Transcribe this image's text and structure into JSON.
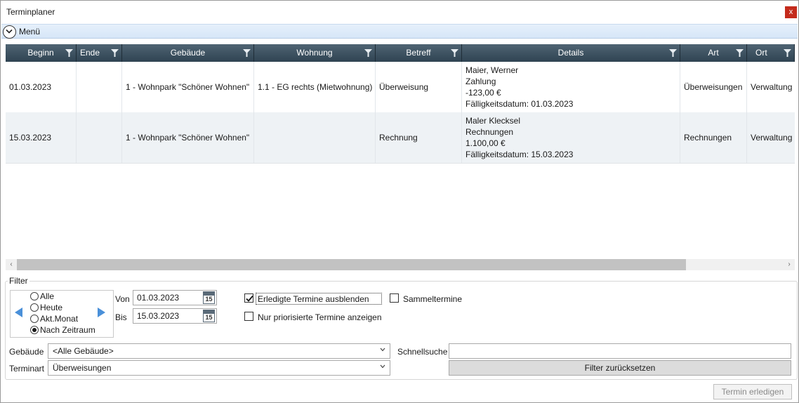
{
  "window": {
    "title": "Terminplaner",
    "close_label": "x"
  },
  "menu": {
    "label": "Menü"
  },
  "grid": {
    "columns": [
      "Beginn",
      "Ende",
      "Gebäude",
      "Wohnung",
      "Betreff",
      "Details",
      "Art",
      "Ort"
    ],
    "rows": [
      {
        "beginn": "01.03.2023",
        "ende": "",
        "gebaeude": "1 - Wohnpark \"Schöner Wohnen\"",
        "wohnung": "1.1 - EG rechts (Mietwohnung)",
        "betreff": "Überweisung",
        "details": [
          "Maier, Werner",
          "Zahlung",
          "-123,00 €",
          "Fälligkeitsdatum: 01.03.2023"
        ],
        "art": "Überweisungen",
        "ort": "Verwaltung"
      },
      {
        "beginn": "15.03.2023",
        "ende": "",
        "gebaeude": "1 - Wohnpark \"Schöner Wohnen\"",
        "wohnung": "",
        "betreff": "Rechnung",
        "details": [
          "Maler Klecksel",
          "Rechnungen",
          "1.100,00 €",
          "Fälligkeitsdatum: 15.03.2023"
        ],
        "art": "Rechnungen",
        "ort": "Verwaltung"
      }
    ]
  },
  "filter": {
    "legend": "Filter",
    "range_options": [
      "Alle",
      "Heute",
      "Akt.Monat",
      "Nach Zeitraum"
    ],
    "selected_range": "Nach Zeitraum",
    "von_label": "Von",
    "von_value": "01.03.2023",
    "bis_label": "Bis",
    "bis_value": "15.03.2023",
    "calendar_day": "15",
    "hide_done_label": "Erledigte Termine ausblenden",
    "hide_done_checked": true,
    "priority_label": "Nur priorisierte Termine anzeigen",
    "priority_checked": false,
    "sammel_label": "Sammeltermine",
    "sammel_checked": false,
    "gebaeude_label": "Gebäude",
    "gebaeude_value": "<Alle Gebäude>",
    "terminart_label": "Terminart",
    "terminart_value": "Überweisungen",
    "schnellsuche_label": "Schnellsuche",
    "schnellsuche_value": "",
    "reset_button": "Filter zurücksetzen"
  },
  "footer": {
    "done_button": "Termin erledigen"
  },
  "colors": {
    "header_bg": "#3c505f",
    "alt_row": "#eef2f5",
    "accent": "#4a90d9",
    "close_bg": "#c42b1c"
  }
}
